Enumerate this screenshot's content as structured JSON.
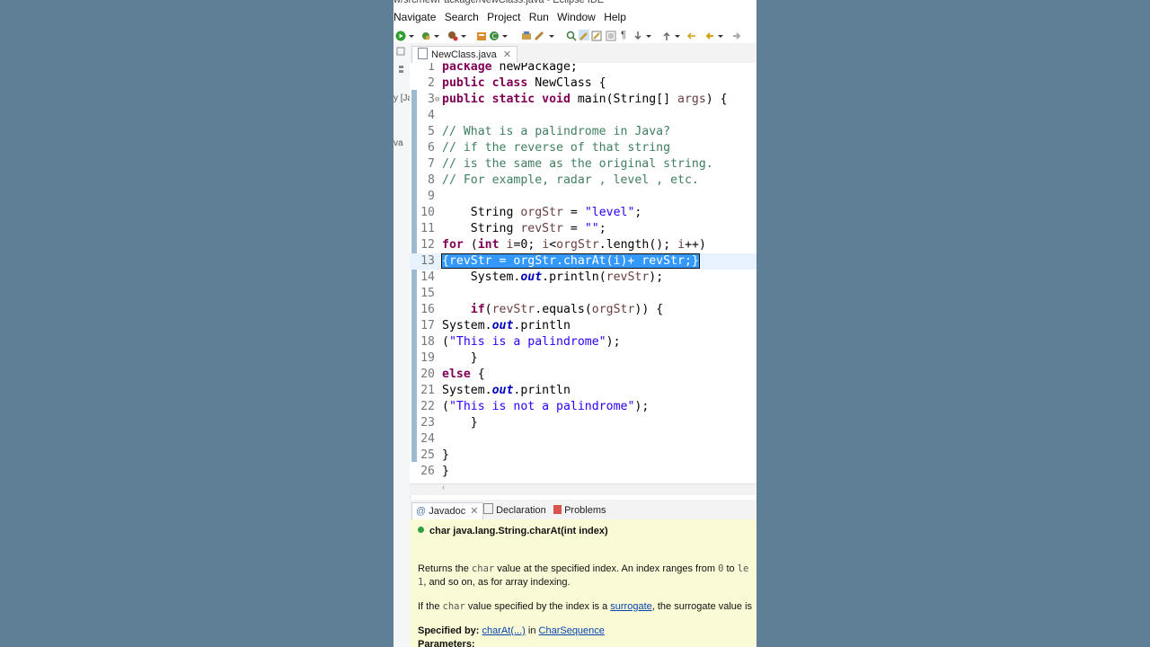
{
  "window": {
    "title": "w/src/newPackage/NewClass.java - Eclipse IDE"
  },
  "menu": [
    "Navigate",
    "Search",
    "Project",
    "Run",
    "Window",
    "Help"
  ],
  "left_strip": {
    "frag1": "y [Ja",
    "frag2": "va"
  },
  "editor": {
    "tab_label": "NewClass.java",
    "lines": [
      {
        "n": "1",
        "segments": [
          {
            "k": "kw",
            "t": "package"
          },
          {
            "k": "p",
            "t": " newPackage;"
          }
        ]
      },
      {
        "n": "2",
        "segments": [
          {
            "k": "kw",
            "t": "public class"
          },
          {
            "k": "p",
            "t": " NewClass {"
          }
        ]
      },
      {
        "n": "3",
        "segments": [
          {
            "k": "kw",
            "t": "public static void"
          },
          {
            "k": "p",
            "t": " main(String[] "
          },
          {
            "k": "vr",
            "t": "args"
          },
          {
            "k": "p",
            "t": ") {"
          }
        ]
      },
      {
        "n": "4",
        "segments": []
      },
      {
        "n": "5",
        "segments": [
          {
            "k": "cm",
            "t": "// What is a palindrome in Java?"
          }
        ]
      },
      {
        "n": "6",
        "segments": [
          {
            "k": "cm",
            "t": "// if the reverse of that string"
          }
        ]
      },
      {
        "n": "7",
        "segments": [
          {
            "k": "cm",
            "t": "// is the same as the original string."
          }
        ]
      },
      {
        "n": "8",
        "segments": [
          {
            "k": "cm",
            "t": "// For example, radar , level , etc."
          }
        ]
      },
      {
        "n": "9",
        "segments": []
      },
      {
        "n": "10",
        "segments": [
          {
            "k": "p",
            "t": "    String "
          },
          {
            "k": "vr",
            "t": "orgStr"
          },
          {
            "k": "p",
            "t": " = "
          },
          {
            "k": "st",
            "t": "\"level\""
          },
          {
            "k": "p",
            "t": ";"
          }
        ]
      },
      {
        "n": "11",
        "segments": [
          {
            "k": "p",
            "t": "    String "
          },
          {
            "k": "vr",
            "t": "revStr"
          },
          {
            "k": "p",
            "t": " = "
          },
          {
            "k": "st",
            "t": "\"\""
          },
          {
            "k": "p",
            "t": ";"
          }
        ]
      },
      {
        "n": "12",
        "segments": [
          {
            "k": "kw",
            "t": "for"
          },
          {
            "k": "p",
            "t": " ("
          },
          {
            "k": "kw",
            "t": "int"
          },
          {
            "k": "p",
            "t": " "
          },
          {
            "k": "vr",
            "t": "i"
          },
          {
            "k": "p",
            "t": "=0; "
          },
          {
            "k": "vr",
            "t": "i"
          },
          {
            "k": "p",
            "t": "<"
          },
          {
            "k": "vr",
            "t": "orgStr"
          },
          {
            "k": "p",
            "t": ".length(); "
          },
          {
            "k": "vr",
            "t": "i"
          },
          {
            "k": "p",
            "t": "++)"
          }
        ]
      },
      {
        "n": "13",
        "segments": [
          {
            "k": "sel",
            "t": "{revStr = orgStr.charAt(i)+ revStr;}"
          }
        ]
      },
      {
        "n": "14",
        "segments": [
          {
            "k": "p",
            "t": "    System."
          },
          {
            "k": "fld",
            "t": "out"
          },
          {
            "k": "p",
            "t": ".println("
          },
          {
            "k": "vr",
            "t": "revStr"
          },
          {
            "k": "p",
            "t": ");"
          }
        ]
      },
      {
        "n": "15",
        "segments": []
      },
      {
        "n": "16",
        "segments": [
          {
            "k": "p",
            "t": "    "
          },
          {
            "k": "kw",
            "t": "if"
          },
          {
            "k": "p",
            "t": "("
          },
          {
            "k": "vr",
            "t": "revStr"
          },
          {
            "k": "p",
            "t": ".equals("
          },
          {
            "k": "vr",
            "t": "orgStr"
          },
          {
            "k": "p",
            "t": ")) {"
          }
        ]
      },
      {
        "n": "17",
        "segments": [
          {
            "k": "p",
            "t": "System."
          },
          {
            "k": "fld",
            "t": "out"
          },
          {
            "k": "p",
            "t": ".println"
          }
        ]
      },
      {
        "n": "18",
        "segments": [
          {
            "k": "p",
            "t": "("
          },
          {
            "k": "st",
            "t": "\"This is a palindrome\""
          },
          {
            "k": "p",
            "t": ");"
          }
        ]
      },
      {
        "n": "19",
        "segments": [
          {
            "k": "p",
            "t": "    }"
          }
        ]
      },
      {
        "n": "20",
        "segments": [
          {
            "k": "kw",
            "t": "else"
          },
          {
            "k": "p",
            "t": " {"
          }
        ]
      },
      {
        "n": "21",
        "segments": [
          {
            "k": "p",
            "t": "System."
          },
          {
            "k": "fld",
            "t": "out"
          },
          {
            "k": "p",
            "t": ".println"
          }
        ]
      },
      {
        "n": "22",
        "segments": [
          {
            "k": "p",
            "t": "("
          },
          {
            "k": "st",
            "t": "\"This is not a palindrome\""
          },
          {
            "k": "p",
            "t": ");"
          }
        ]
      },
      {
        "n": "23",
        "segments": [
          {
            "k": "p",
            "t": "    }"
          }
        ]
      },
      {
        "n": "24",
        "segments": []
      },
      {
        "n": "25",
        "segments": [
          {
            "k": "p",
            "t": "}"
          }
        ]
      },
      {
        "n": "26",
        "segments": [
          {
            "k": "p",
            "t": "}"
          }
        ]
      }
    ]
  },
  "bottom_tabs": [
    {
      "label": "Javadoc",
      "icon": "at-sign-icon"
    },
    {
      "label": "Declaration",
      "icon": "declaration-icon"
    },
    {
      "label": "Problems",
      "icon": "problems-icon"
    }
  ],
  "javadoc": {
    "signature": "char java.lang.String.charAt(int index)",
    "p1_a": "Returns the ",
    "p1_code": "char",
    "p1_b": " value at the specified index. An index ranges from ",
    "p1_code2": "0",
    "p1_c": " to ",
    "p1_code3": "le",
    "p1_cont_code": "1",
    "p1_cont": ", and so on, as for array indexing.",
    "p2_a": "If the ",
    "p2_code": "char",
    "p2_b": " value specified by the index is a ",
    "p2_link": "surrogate",
    "p2_c": ", the surrogate value is",
    "specified_by_label": "Specified by:",
    "specified_by_link": "charAt(...)",
    "specified_by_in": " in ",
    "specified_by_link2": "CharSequence",
    "parameters_label": "Parameters:"
  },
  "colors": {
    "background": "#5f7f96",
    "selection": "#3399ff",
    "javadoc_bg": "#fbfad7"
  }
}
